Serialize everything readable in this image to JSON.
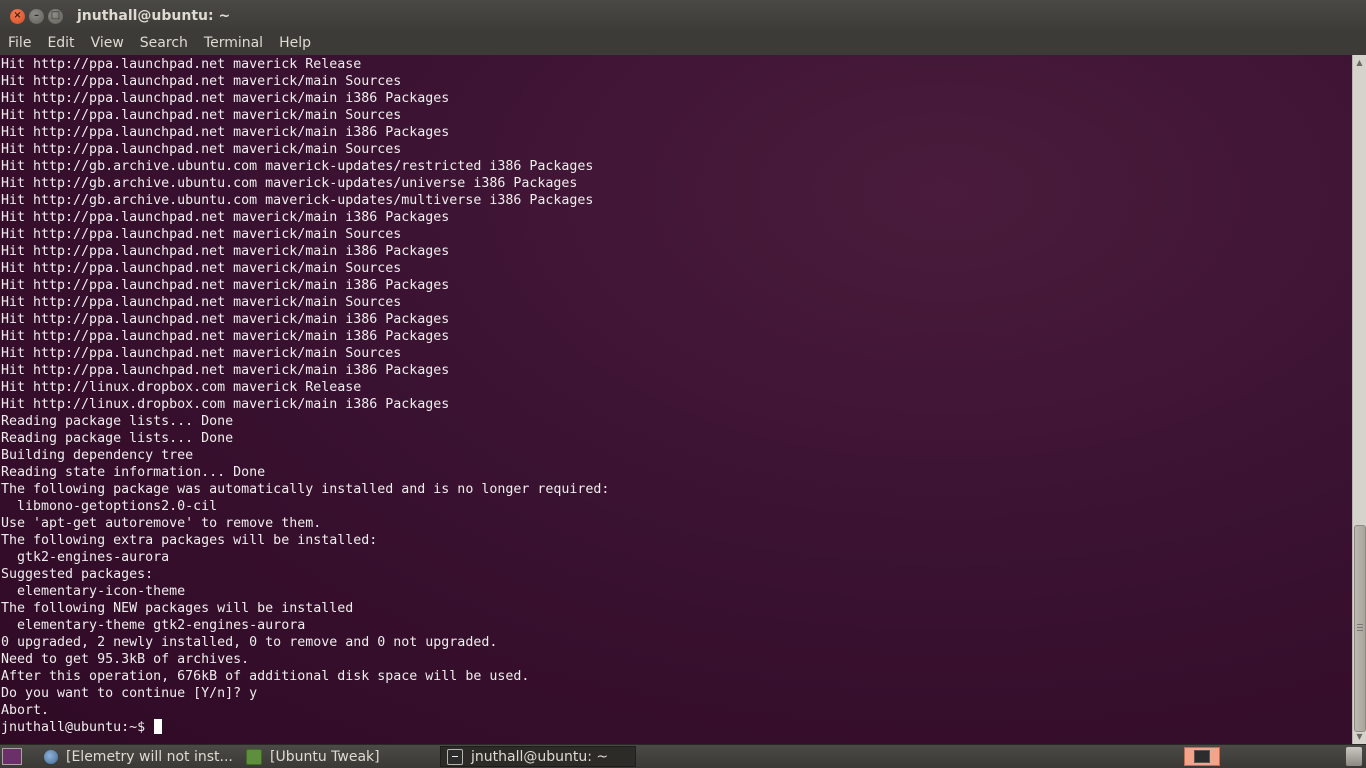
{
  "window": {
    "title": "jnuthall@ubuntu: ~",
    "buttons": [
      "close-icon",
      "minimize-icon",
      "maximize-icon"
    ]
  },
  "menu": [
    "File",
    "Edit",
    "View",
    "Search",
    "Terminal",
    "Help"
  ],
  "terminal": {
    "lines": [
      "Hit http://ppa.launchpad.net maverick Release",
      "Hit http://ppa.launchpad.net maverick/main Sources",
      "Hit http://ppa.launchpad.net maverick/main i386 Packages",
      "Hit http://ppa.launchpad.net maverick/main Sources",
      "Hit http://ppa.launchpad.net maverick/main i386 Packages",
      "Hit http://ppa.launchpad.net maverick/main Sources",
      "Hit http://gb.archive.ubuntu.com maverick-updates/restricted i386 Packages",
      "Hit http://gb.archive.ubuntu.com maverick-updates/universe i386 Packages",
      "Hit http://gb.archive.ubuntu.com maverick-updates/multiverse i386 Packages",
      "Hit http://ppa.launchpad.net maverick/main i386 Packages",
      "Hit http://ppa.launchpad.net maverick/main Sources",
      "Hit http://ppa.launchpad.net maverick/main i386 Packages",
      "Hit http://ppa.launchpad.net maverick/main Sources",
      "Hit http://ppa.launchpad.net maverick/main i386 Packages",
      "Hit http://ppa.launchpad.net maverick/main Sources",
      "Hit http://ppa.launchpad.net maverick/main i386 Packages",
      "Hit http://ppa.launchpad.net maverick/main i386 Packages",
      "Hit http://ppa.launchpad.net maverick/main Sources",
      "Hit http://ppa.launchpad.net maverick/main i386 Packages",
      "Hit http://linux.dropbox.com maverick Release",
      "Hit http://linux.dropbox.com maverick/main i386 Packages",
      "Reading package lists... Done",
      "Reading package lists... Done",
      "Building dependency tree",
      "Reading state information... Done",
      "The following package was automatically installed and is no longer required:",
      "  libmono-getoptions2.0-cil",
      "Use 'apt-get autoremove' to remove them.",
      "The following extra packages will be installed:",
      "  gtk2-engines-aurora",
      "Suggested packages:",
      "  elementary-icon-theme",
      "The following NEW packages will be installed",
      "  elementary-theme gtk2-engines-aurora",
      "0 upgraded, 2 newly installed, 0 to remove and 0 not upgraded.",
      "Need to get 95.3kB of archives.",
      "After this operation, 676kB of additional disk space will be used.",
      "Do you want to continue [Y/n]? y",
      "Abort."
    ],
    "prompt": "jnuthall@ubuntu:~$ "
  },
  "scrollbar": {
    "position_fraction": 0.68
  },
  "taskbar": {
    "tasks": [
      {
        "label": "[Elemetry will not inst...",
        "icon": "browser-icon",
        "active": false
      },
      {
        "label": "[Ubuntu Tweak]",
        "icon": "ubuntu-tweak-icon",
        "active": false
      },
      {
        "label": "jnuthall@ubuntu: ~",
        "icon": "terminal-icon",
        "active": true
      }
    ]
  },
  "colors": {
    "terminal_bg": "#300a24",
    "terminal_fg": "#eeeeec",
    "titlebar": "#3c3b37",
    "close_button": "#e05a2b"
  }
}
